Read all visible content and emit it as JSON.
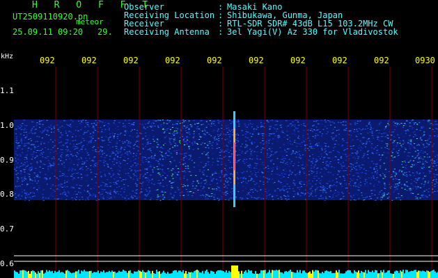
{
  "header": {
    "program": "H R O F F T",
    "filename": "UT2509110920.pn",
    "tag": "meteor",
    "datetime": "25.09.11 09:20",
    "frame": "29."
  },
  "info": [
    {
      "label": "Observer",
      "value": "Masaki Kano"
    },
    {
      "label": "Receiving Location",
      "value": "Shibukawa, Gunma, Japan"
    },
    {
      "label": "Receiver",
      "value": "RTL-SDR SDR# 43dB L15 103.2MHz CW"
    },
    {
      "label": "Receiving Antenna",
      "value": "3el Yagi(V) Az 330 for Vladivostok"
    }
  ],
  "separator": ":",
  "axis": {
    "unit": "kHz",
    "freq_labels": [
      "1.1",
      "1.0",
      "0.9",
      "0.8",
      "0.7",
      "0.6"
    ],
    "time_labels": [
      "092",
      "092",
      "092",
      "092",
      "092",
      "092",
      "092",
      "092",
      "092",
      "0930"
    ]
  },
  "colors": {
    "header_green": "#33ff33",
    "info_cyan": "#55ffff",
    "time_yellow": "#ffff00",
    "grid": "#7a0000",
    "noise_bar": "#00e8ff"
  }
}
